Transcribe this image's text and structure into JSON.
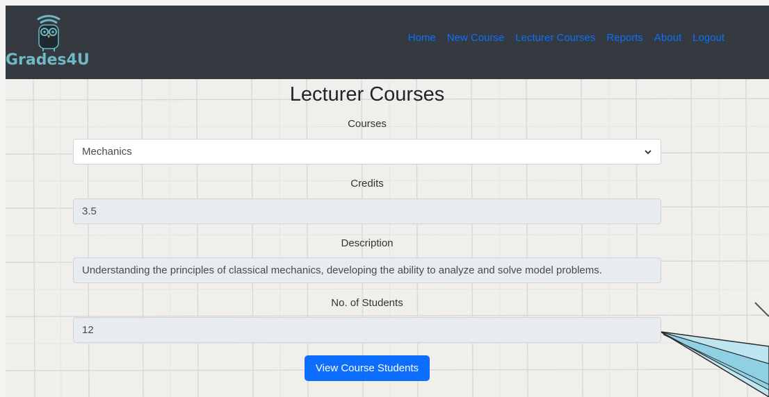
{
  "brand": {
    "name": "Grades4U",
    "logo_icon": "owl-graduate-icon"
  },
  "nav": {
    "items": [
      {
        "label": "Home"
      },
      {
        "label": "New Course"
      },
      {
        "label": "Lecturer Courses"
      },
      {
        "label": "Reports"
      },
      {
        "label": "About"
      },
      {
        "label": "Logout"
      }
    ]
  },
  "page": {
    "title": "Lecturer Courses"
  },
  "form": {
    "courses": {
      "label": "Courses",
      "selected": "Mechanics"
    },
    "credits": {
      "label": "Credits",
      "value": "3.5"
    },
    "description": {
      "label": "Description",
      "value": "Understanding the principles of classical mechanics, developing the ability to analyze and solve model problems."
    },
    "students": {
      "label": "No. of Students",
      "value": "12"
    },
    "view_button_label": "View Course Students"
  },
  "colors": {
    "navbar_bg": "#343a40",
    "link": "#0d6efd",
    "brand": "#6fb8c4",
    "button": "#0d6efd"
  }
}
